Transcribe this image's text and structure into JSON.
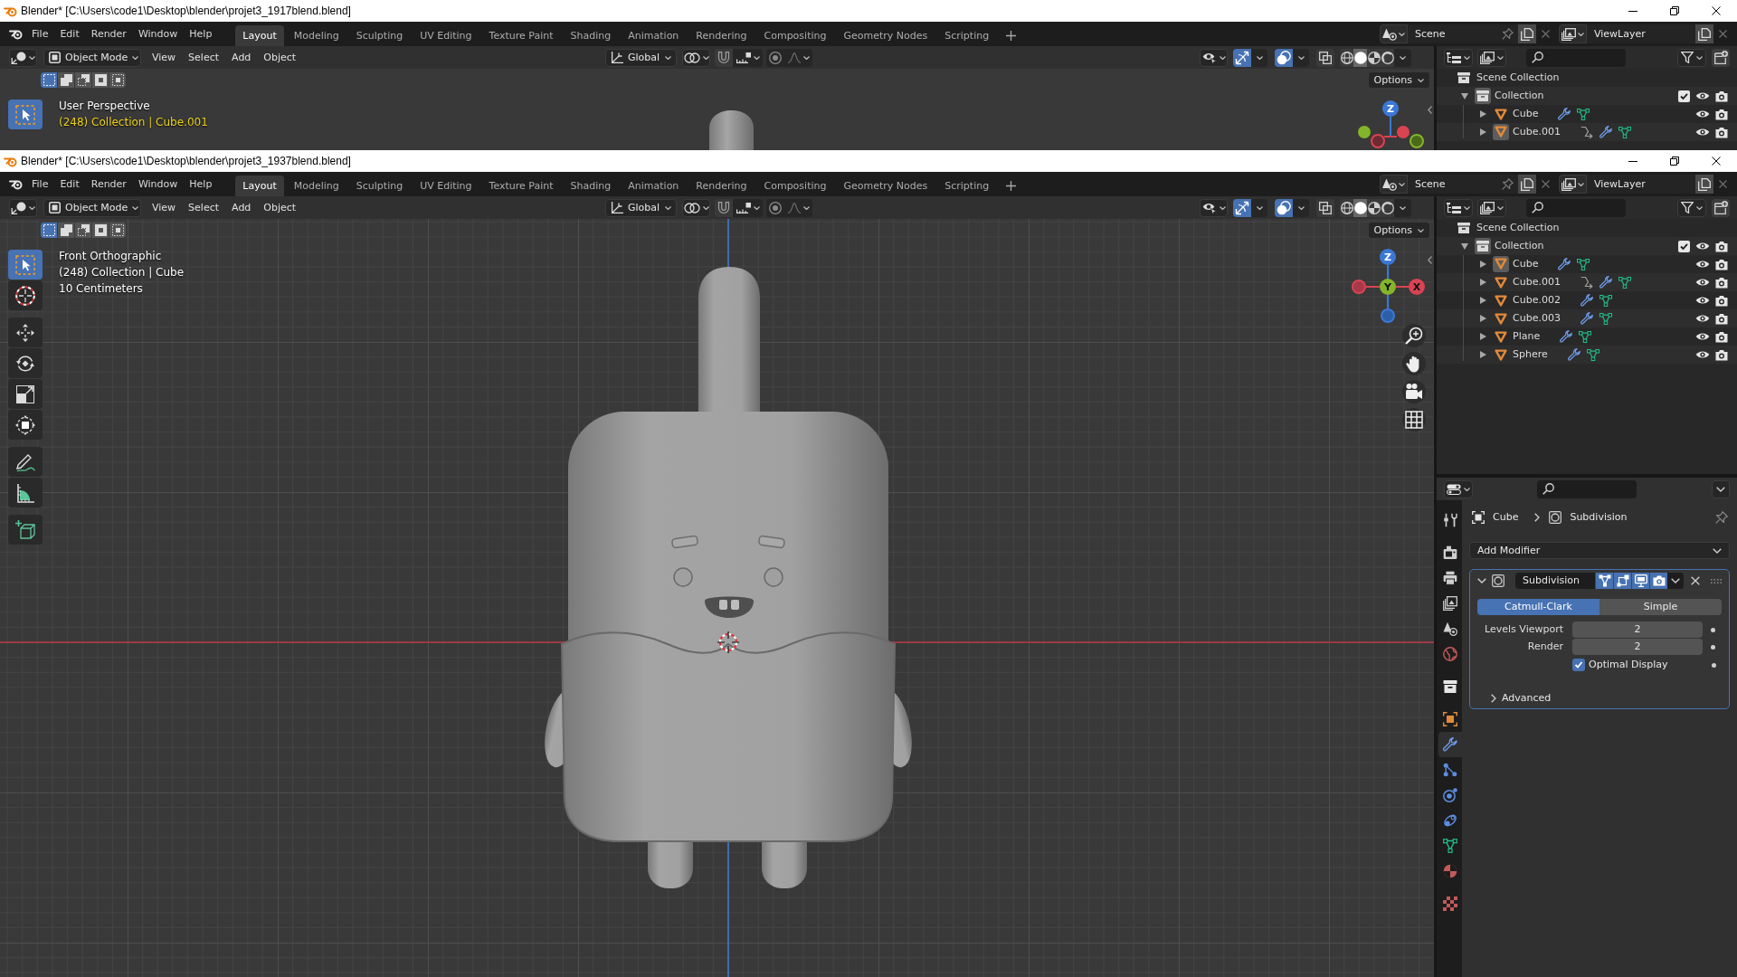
{
  "windows": [
    {
      "title": "Blender* [C:\\Users\\code1\\Desktop\\blender\\projet3_1917blend.blend]",
      "menus": [
        "File",
        "Edit",
        "Render",
        "Window",
        "Help"
      ],
      "workspaces": [
        {
          "label": "Layout",
          "selected": true
        },
        {
          "label": "Modeling",
          "selected": false
        },
        {
          "label": "Sculpting",
          "selected": false
        },
        {
          "label": "UV Editing",
          "selected": false
        },
        {
          "label": "Texture Paint",
          "selected": false
        },
        {
          "label": "Shading",
          "selected": false
        },
        {
          "label": "Animation",
          "selected": false
        },
        {
          "label": "Rendering",
          "selected": false
        },
        {
          "label": "Compositing",
          "selected": false
        },
        {
          "label": "Geometry Nodes",
          "selected": false
        },
        {
          "label": "Scripting",
          "selected": false
        }
      ],
      "scene": "Scene",
      "view_layer": "ViewLayer",
      "header": {
        "mode": "Object Mode",
        "menus": [
          "View",
          "Select",
          "Add",
          "Object"
        ],
        "orientation": "Global",
        "gizmos": true,
        "overlays": true,
        "xray": false,
        "shading": [
          {
            "kind": "wireframe",
            "selected": false
          },
          {
            "kind": "solid",
            "selected": true
          },
          {
            "kind": "material",
            "selected": false
          },
          {
            "kind": "rendered",
            "selected": false
          }
        ]
      },
      "tool_settings": {
        "select_modes": [
          {
            "kind": "set",
            "selected": true
          },
          {
            "kind": "extend",
            "selected": false
          },
          {
            "kind": "subtract",
            "selected": false
          },
          {
            "kind": "invert",
            "selected": false
          },
          {
            "kind": "intersect",
            "selected": false
          }
        ],
        "options": "Options"
      },
      "tools": [
        {
          "kind": "select",
          "selected": true
        }
      ],
      "viewport": {
        "kind": "perspective",
        "view_name": "User Perspective",
        "object_info": {
          "text": "(248) Collection | Cube.001",
          "keyframed": true
        },
        "gizmo": [
          {
            "label": "Z",
            "kind": "z"
          }
        ]
      },
      "outliner": {
        "root": "Scene Collection",
        "collections": [
          {
            "name": "Collection",
            "expanded": true,
            "checked": true,
            "active": true,
            "objects": [
              {
                "name": "Cube",
                "expanded": false,
                "active": false,
                "linked": false
              },
              {
                "name": "Cube.001",
                "expanded": false,
                "active": true,
                "linked": true
              }
            ]
          }
        ]
      }
    },
    {
      "title": "Blender* [C:\\Users\\code1\\Desktop\\blender\\projet3_1937blend.blend]",
      "menus": [
        "File",
        "Edit",
        "Render",
        "Window",
        "Help"
      ],
      "workspaces": [
        {
          "label": "Layout",
          "selected": true
        },
        {
          "label": "Modeling",
          "selected": false
        },
        {
          "label": "Sculpting",
          "selected": false
        },
        {
          "label": "UV Editing",
          "selected": false
        },
        {
          "label": "Texture Paint",
          "selected": false
        },
        {
          "label": "Shading",
          "selected": false
        },
        {
          "label": "Animation",
          "selected": false
        },
        {
          "label": "Rendering",
          "selected": false
        },
        {
          "label": "Compositing",
          "selected": false
        },
        {
          "label": "Geometry Nodes",
          "selected": false
        },
        {
          "label": "Scripting",
          "selected": false
        }
      ],
      "scene": "Scene",
      "view_layer": "ViewLayer",
      "header": {
        "mode": "Object Mode",
        "menus": [
          "View",
          "Select",
          "Add",
          "Object"
        ],
        "orientation": "Global",
        "gizmos": true,
        "overlays": true,
        "xray": false,
        "shading": [
          {
            "kind": "wireframe",
            "selected": false
          },
          {
            "kind": "solid",
            "selected": true
          },
          {
            "kind": "material",
            "selected": false
          },
          {
            "kind": "rendered",
            "selected": false
          }
        ]
      },
      "tool_settings": {
        "select_modes": [
          {
            "kind": "set",
            "selected": true
          },
          {
            "kind": "extend",
            "selected": false
          },
          {
            "kind": "subtract",
            "selected": false
          },
          {
            "kind": "invert",
            "selected": false
          },
          {
            "kind": "intersect",
            "selected": false
          }
        ],
        "options": "Options"
      },
      "tools": [
        {
          "kind": "select",
          "selected": true
        },
        {
          "kind": "cursor",
          "selected": false
        },
        {
          "kind": "move",
          "selected": false
        },
        {
          "kind": "rotate",
          "selected": false
        },
        {
          "kind": "scale",
          "selected": false
        },
        {
          "kind": "transform",
          "selected": false
        },
        {
          "kind": "annotate",
          "selected": false
        },
        {
          "kind": "measure",
          "selected": false
        },
        {
          "kind": "addcube",
          "selected": false
        }
      ],
      "viewport": {
        "kind": "front",
        "view_name": "Front Orthographic",
        "object_info": {
          "text": "(248) Collection | Cube",
          "keyframed": false
        },
        "scale": "10 Centimeters",
        "gizmo": [
          {
            "label": "Z",
            "kind": "z"
          },
          {
            "label": "Y",
            "kind": "y"
          },
          {
            "label": "X",
            "kind": "x"
          }
        ],
        "nav": [
          {
            "kind": "zoom"
          },
          {
            "kind": "pan"
          },
          {
            "kind": "camera"
          },
          {
            "kind": "ortho"
          }
        ]
      },
      "outliner": {
        "root": "Scene Collection",
        "collections": [
          {
            "name": "Collection",
            "expanded": true,
            "checked": true,
            "active": true,
            "objects": [
              {
                "name": "Cube",
                "expanded": false,
                "active": true,
                "linked": false
              },
              {
                "name": "Cube.001",
                "expanded": false,
                "active": false,
                "linked": true
              },
              {
                "name": "Cube.002",
                "expanded": false,
                "active": false,
                "linked": false
              },
              {
                "name": "Cube.003",
                "expanded": false,
                "active": false,
                "linked": false
              },
              {
                "name": "Plane",
                "expanded": false,
                "active": false,
                "linked": false
              },
              {
                "name": "Sphere",
                "expanded": false,
                "active": false,
                "linked": false
              }
            ]
          }
        ]
      },
      "properties": {
        "tabs": [
          {
            "kind": "tool",
            "selected": false
          },
          {
            "kind": "render",
            "selected": false
          },
          {
            "kind": "output",
            "selected": false
          },
          {
            "kind": "viewlayer",
            "selected": false
          },
          {
            "kind": "scene",
            "selected": false
          },
          {
            "kind": "world",
            "selected": false
          },
          {
            "kind": "collection",
            "selected": false
          },
          {
            "kind": "object",
            "selected": false
          },
          {
            "kind": "modifiers",
            "selected": true
          },
          {
            "kind": "particles",
            "selected": false
          },
          {
            "kind": "physics",
            "selected": false
          },
          {
            "kind": "constraints",
            "selected": false
          },
          {
            "kind": "data",
            "selected": false
          },
          {
            "kind": "material",
            "selected": false
          },
          {
            "kind": "texture",
            "selected": false
          }
        ],
        "breadcrumb": [
          "Cube",
          "Subdivision"
        ],
        "add_modifier": "Add Modifier",
        "modifier": {
          "name": "Subdivision",
          "expanded": true,
          "toggles": [
            {
              "kind": "cage",
              "on": true
            },
            {
              "kind": "editmode",
              "on": true
            },
            {
              "kind": "viewport",
              "on": true
            },
            {
              "kind": "render",
              "on": true
            }
          ],
          "types": [
            {
              "label": "Catmull-Clark",
              "selected": true
            },
            {
              "label": "Simple",
              "selected": false
            }
          ],
          "fields": [
            {
              "label": "Levels Viewport",
              "value": "2"
            },
            {
              "label": "Render",
              "value": "2"
            }
          ],
          "optimal_display": {
            "label": "Optimal Display",
            "checked": true
          },
          "advanced": {
            "label": "Advanced",
            "expanded": false
          }
        }
      }
    }
  ]
}
